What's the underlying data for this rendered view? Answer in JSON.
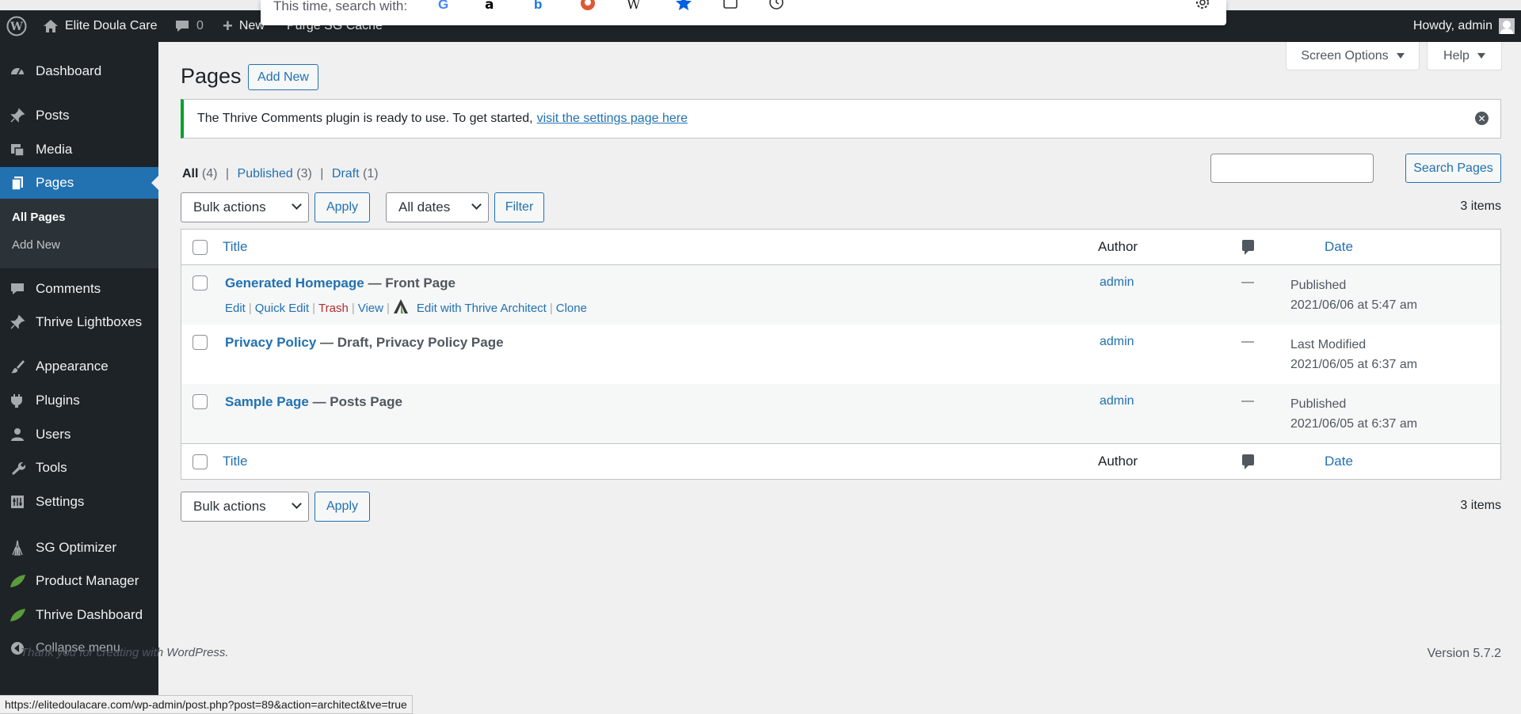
{
  "browser": {
    "search_label": "This time, search with:",
    "status_url": "https://elitedoulacare.com/wp-admin/post.php?post=89&action=architect&tve=true"
  },
  "adminbar": {
    "site_name": "Elite Doula Care",
    "comments_count": "0",
    "new_label": "New",
    "purge_label": "Purge SG Cache",
    "howdy": "Howdy, admin"
  },
  "sidebar": {
    "items": [
      {
        "label": "Dashboard",
        "icon": "dashboard-icon"
      },
      {
        "label": "Posts",
        "icon": "pin-icon"
      },
      {
        "label": "Media",
        "icon": "media-icon"
      },
      {
        "label": "Pages",
        "icon": "pages-icon"
      },
      {
        "label": "Comments",
        "icon": "comments-icon"
      },
      {
        "label": "Thrive Lightboxes",
        "icon": "pin-icon"
      },
      {
        "label": "Appearance",
        "icon": "brush-icon"
      },
      {
        "label": "Plugins",
        "icon": "plugin-icon"
      },
      {
        "label": "Users",
        "icon": "user-icon"
      },
      {
        "label": "Tools",
        "icon": "wrench-icon"
      },
      {
        "label": "Settings",
        "icon": "settings-icon"
      },
      {
        "label": "SG Optimizer",
        "icon": "sg-icon"
      },
      {
        "label": "Product Manager",
        "icon": "leaf-icon"
      },
      {
        "label": "Thrive Dashboard",
        "icon": "leaf-icon"
      },
      {
        "label": "Collapse menu",
        "icon": "collapse-icon"
      }
    ],
    "submenu": [
      "All Pages",
      "Add New"
    ]
  },
  "header": {
    "screen_options": "Screen Options",
    "help": "Help",
    "title": "Pages",
    "add_new": "Add New"
  },
  "notice": {
    "text": "The Thrive Comments plugin is ready to use. To get started,",
    "link": "visit the settings page here"
  },
  "filters": {
    "all": "All",
    "all_count": "(4)",
    "published": "Published",
    "published_count": "(3)",
    "draft": "Draft",
    "draft_count": "(1)",
    "sep": "|",
    "search_button": "Search Pages",
    "bulk_actions": "Bulk actions",
    "apply": "Apply",
    "all_dates": "All dates",
    "filter": "Filter",
    "items": "3 items"
  },
  "table": {
    "columns": {
      "title": "Title",
      "author": "Author",
      "date": "Date"
    },
    "rows": [
      {
        "title": "Generated Homepage",
        "state": "— Front Page",
        "author": "admin",
        "comments": "—",
        "date_status": "Published",
        "date": "2021/06/06 at 5:47 am",
        "actions": [
          "Edit",
          "Quick Edit",
          "Trash",
          "View",
          "Edit with Thrive Architect",
          "Clone"
        ]
      },
      {
        "title": "Privacy Policy",
        "state": "— Draft, Privacy Policy Page",
        "author": "admin",
        "comments": "—",
        "date_status": "Last Modified",
        "date": "2021/06/05 at 6:37 am"
      },
      {
        "title": "Sample Page",
        "state": "— Posts Page",
        "author": "admin",
        "comments": "—",
        "date_status": "Published",
        "date": "2021/06/05 at 6:37 am"
      }
    ]
  },
  "footer": {
    "thanks": "Thank you for creating with WordPress.",
    "version": "Version 5.7.2"
  },
  "colors": {
    "accent": "#2271b1",
    "admin_bar": "#1d2327",
    "notice_success": "#00a32a",
    "trash": "#b32d2e"
  }
}
